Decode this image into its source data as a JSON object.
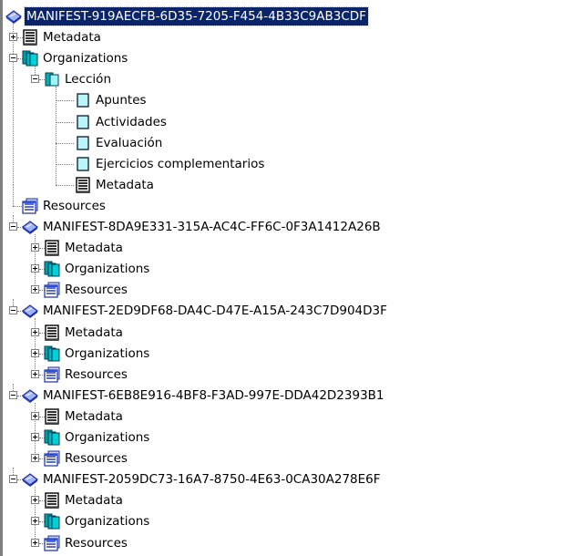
{
  "tree": {
    "root_label": "MANIFEST-919AECFB-6D35-7205-F454-4B33C9AB3CDF",
    "metadata_label": "Metadata",
    "organizations_label": "Organizations",
    "leccion_label": "Lección",
    "items": [
      "Apuntes",
      "Actividades",
      "Evaluación",
      "Ejercicios complementarios"
    ],
    "leccion_metadata_label": "Metadata",
    "resources_label": "Resources",
    "sub_manifests": [
      {
        "label": "MANIFEST-8DA9E331-315A-AC4C-FF6C-0F3A1412A26B",
        "children": [
          "Metadata",
          "Organizations",
          "Resources"
        ]
      },
      {
        "label": "MANIFEST-2ED9DF68-DA4C-D47E-A15A-243C7D904D3F",
        "children": [
          "Metadata",
          "Organizations",
          "Resources"
        ]
      },
      {
        "label": "MANIFEST-6EB8E916-4BF8-F3AD-997E-DDA42D2393B1",
        "children": [
          "Metadata",
          "Organizations",
          "Resources"
        ]
      },
      {
        "label": "MANIFEST-2059DC73-16A7-8750-4E63-0CA30A278E6F",
        "children": [
          "Metadata",
          "Organizations",
          "Resources"
        ]
      }
    ],
    "selected": "root",
    "selection_color": "#0a246a"
  }
}
